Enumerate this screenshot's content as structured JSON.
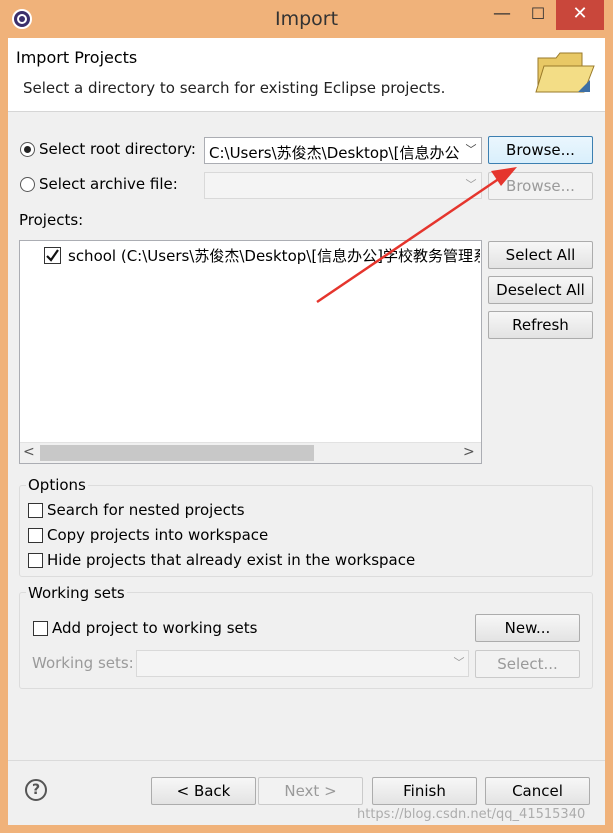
{
  "window": {
    "title": "Import",
    "minimize": "—",
    "maximize": "☐",
    "close": "✕"
  },
  "header": {
    "title": "Import Projects",
    "description": "Select a directory to search for existing Eclipse projects."
  },
  "source": {
    "root_label": "Select root directory:",
    "root_value": "C:\\Users\\苏俊杰\\Desktop\\[信息办公",
    "archive_label": "Select archive file:",
    "browse_label": "Browse...",
    "browse2_label": "Browse..."
  },
  "projects": {
    "label": "Projects:",
    "items": [
      {
        "label": "school (C:\\Users\\苏俊杰\\Desktop\\[信息办公]学校教务管理系",
        "checked": true
      }
    ],
    "select_all": "Select All",
    "deselect_all": "Deselect All",
    "refresh": "Refresh"
  },
  "options": {
    "legend": "Options",
    "items": [
      {
        "label": "Search for nested projects",
        "checked": false
      },
      {
        "label": "Copy projects into workspace",
        "checked": false
      },
      {
        "label": "Hide projects that already exist in the workspace",
        "checked": false
      }
    ]
  },
  "working_sets": {
    "legend": "Working sets",
    "add_label": "Add project to working sets",
    "new_button": "New...",
    "sets_label": "Working sets:",
    "select_button": "Select..."
  },
  "footer": {
    "back": "< Back",
    "next": "Next >",
    "finish": "Finish",
    "cancel": "Cancel",
    "help": "?"
  },
  "watermark": "https://blog.csdn.net/qq_41515340",
  "colors": {
    "title_bar": "#f0b27a",
    "close_button": "#c9473b",
    "annotation_arrow": "#e5352d"
  }
}
